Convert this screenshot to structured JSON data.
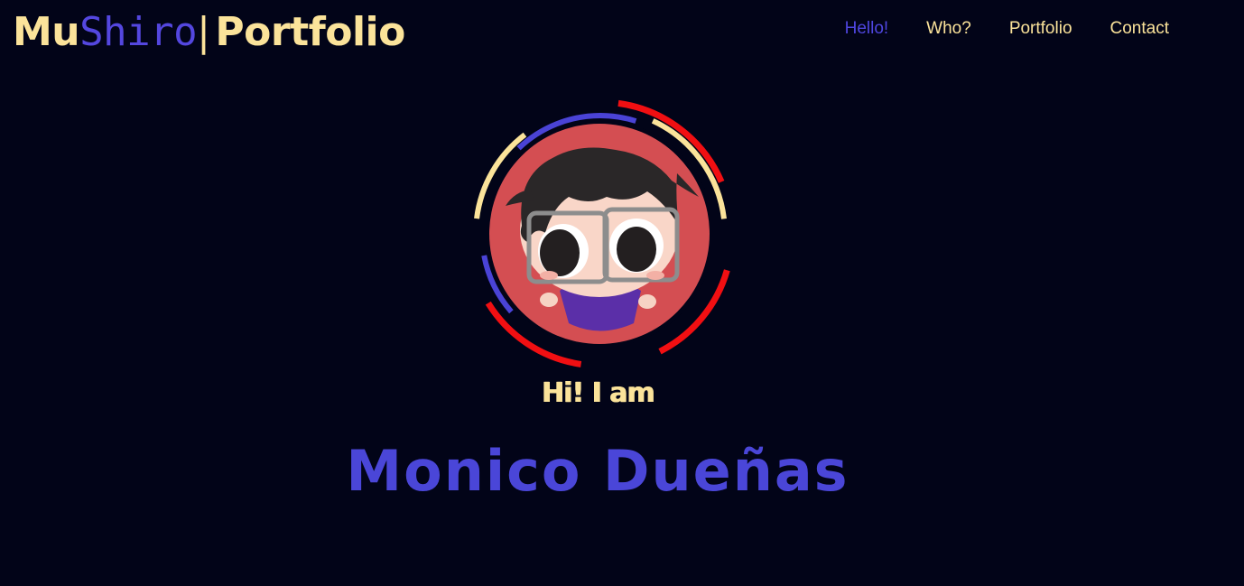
{
  "header": {
    "brand_part1": "Mu",
    "brand_part2": "Shiro",
    "brand_separator": "|",
    "brand_part3": "Portfolio"
  },
  "nav": {
    "items": [
      {
        "label": "Hello!",
        "active": true
      },
      {
        "label": "Who?",
        "active": false
      },
      {
        "label": "Portfolio",
        "active": false
      },
      {
        "label": "Contact",
        "active": false
      }
    ]
  },
  "hero": {
    "greeting": "Hi! I am",
    "name": "Monico Dueñas"
  },
  "colors": {
    "background": "#020418",
    "accent_yellow": "#fbe39a",
    "accent_blue": "#4f46e0",
    "ring_red": "#f10f12",
    "avatar_bg": "#d44e52"
  },
  "icons": {
    "avatar": "chibi-avatar-with-glasses"
  }
}
